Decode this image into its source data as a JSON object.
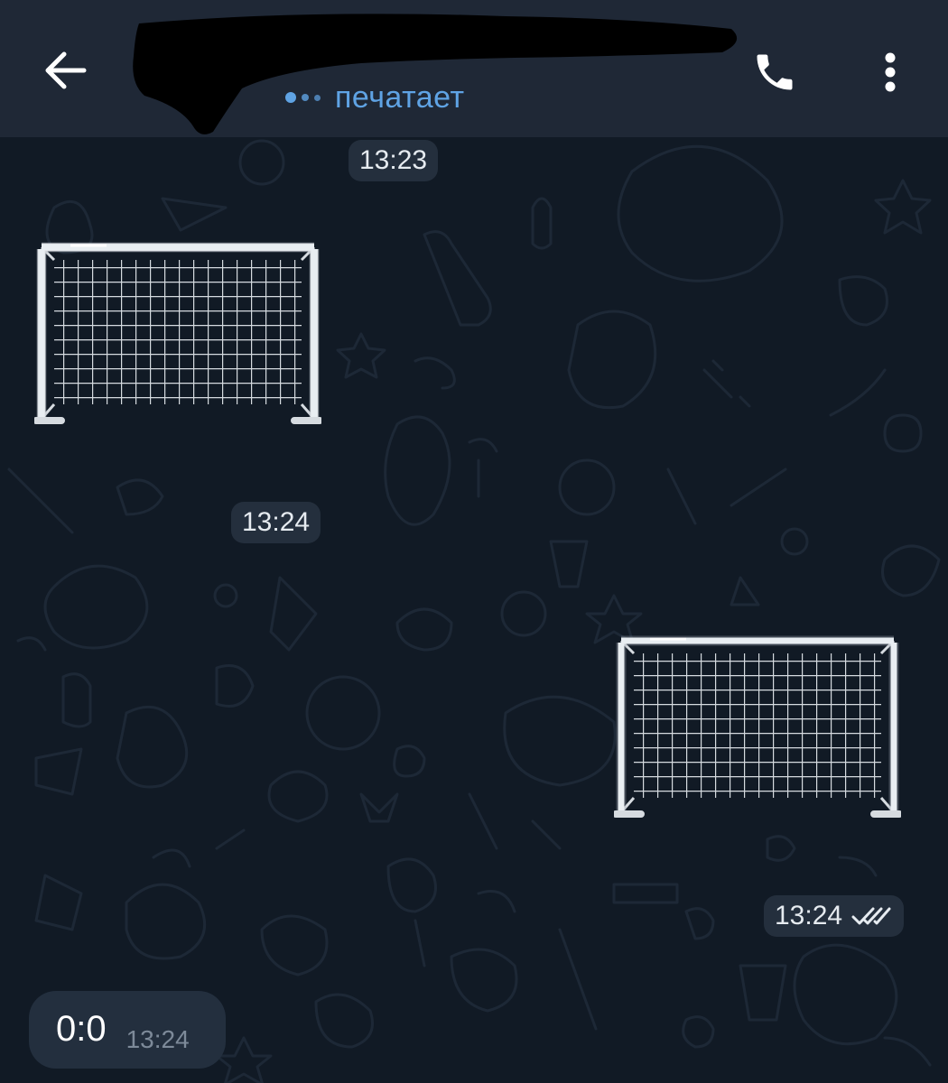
{
  "header": {
    "back_icon": "arrow-left-icon",
    "status_text": "печатает",
    "call_icon": "phone-icon",
    "menu_icon": "more-vertical-icon"
  },
  "colors": {
    "header_bg": "#1f2836",
    "chat_bg": "#111a25",
    "status_accent": "#5fa3e4",
    "pill_bg": "#26313f",
    "bubble_bg": "#232f3e"
  },
  "messages": [
    {
      "type": "sticker",
      "sticker": "goal-net",
      "side": "incoming",
      "time": "13:24"
    },
    {
      "type": "sticker",
      "sticker": "goal-net",
      "side": "outgoing",
      "time": "13:24",
      "read_icon": "double-check-icon"
    },
    {
      "type": "text",
      "side": "incoming",
      "text": "0:0",
      "time": "13:24"
    }
  ],
  "top_time": "13:23"
}
